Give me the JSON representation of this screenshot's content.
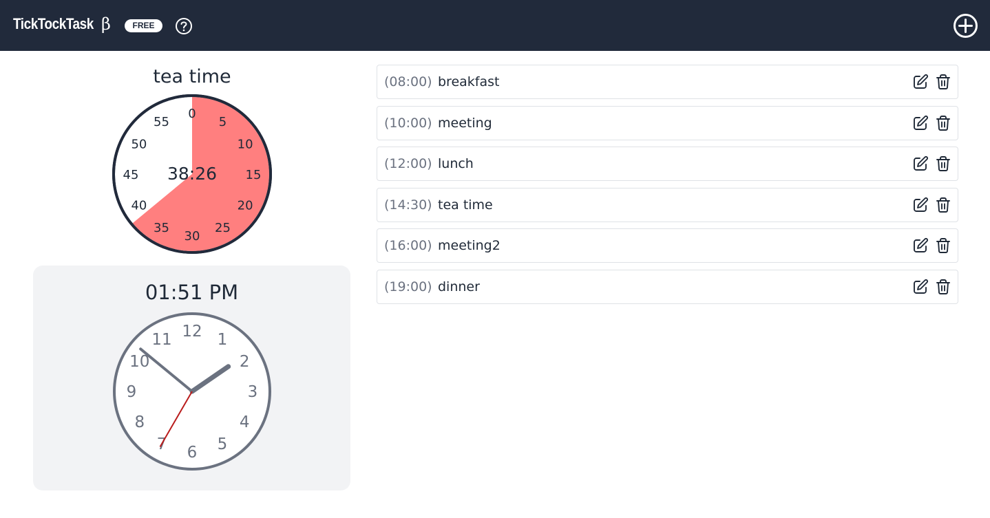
{
  "header": {
    "app_title": "TickTockTask",
    "beta_symbol": "β",
    "badge": "FREE",
    "help_icon": "question-circle-icon",
    "add_icon": "plus-circle-icon",
    "background": "#212a3b"
  },
  "timer": {
    "title": "tea time",
    "remaining": "38:26",
    "remaining_minutes_fraction": 0.64,
    "fill_color": "#ff7f7f",
    "minute_labels": [
      "0",
      "5",
      "10",
      "15",
      "20",
      "25",
      "30",
      "35",
      "40",
      "45",
      "50",
      "55"
    ]
  },
  "clock": {
    "time": "01:51 PM",
    "hour_labels": [
      "12",
      "1",
      "2",
      "3",
      "4",
      "5",
      "6",
      "7",
      "8",
      "9",
      "10",
      "11"
    ],
    "hour": 13,
    "minute": 51,
    "second": 35,
    "second_hand_color": "#b91c1c",
    "hand_color": "#6b7280"
  },
  "tasks": [
    {
      "time": "(08:00)",
      "name": "breakfast"
    },
    {
      "time": "(10:00)",
      "name": "meeting"
    },
    {
      "time": "(12:00)",
      "name": "lunch"
    },
    {
      "time": "(14:30)",
      "name": "tea time"
    },
    {
      "time": "(16:00)",
      "name": "meeting2"
    },
    {
      "time": "(19:00)",
      "name": "dinner"
    }
  ],
  "task_icons": {
    "edit": "edit-icon",
    "delete": "trash-icon"
  }
}
